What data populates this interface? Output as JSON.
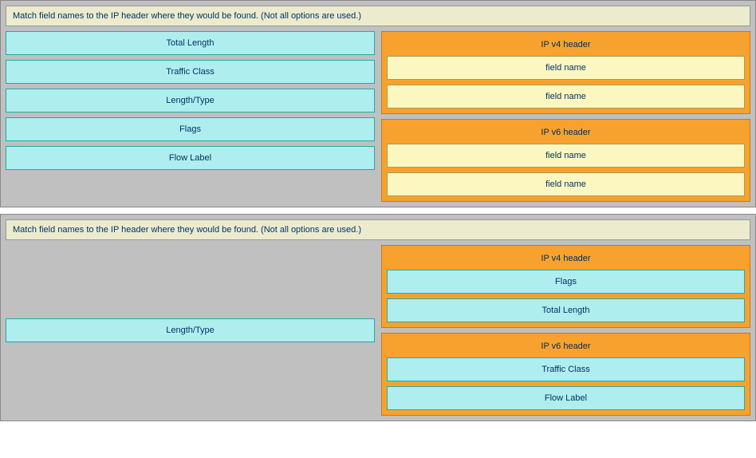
{
  "top": {
    "instruction": "Match field names to the IP header where they would be found. (Not all options are used.)",
    "tokens": [
      "Total Length",
      "Traffic Class",
      "Length/Type",
      "Flags",
      "Flow Label"
    ],
    "groups": [
      {
        "title": "IP v4 header",
        "slots": [
          {
            "filled": false,
            "text": "field name"
          },
          {
            "filled": false,
            "text": "field name"
          }
        ]
      },
      {
        "title": "IP v6 header",
        "slots": [
          {
            "filled": false,
            "text": "field name"
          },
          {
            "filled": false,
            "text": "field name"
          }
        ]
      }
    ]
  },
  "bottom": {
    "instruction": "Match field names to the IP header where they would be found. (Not all options are used.)",
    "tokens": [
      "Length/Type"
    ],
    "groups": [
      {
        "title": "IP v4 header",
        "slots": [
          {
            "filled": true,
            "text": "Flags"
          },
          {
            "filled": true,
            "text": "Total Length"
          }
        ]
      },
      {
        "title": "IP v6 header",
        "slots": [
          {
            "filled": true,
            "text": "Traffic Class"
          },
          {
            "filled": true,
            "text": "Flow Label"
          }
        ]
      }
    ]
  }
}
